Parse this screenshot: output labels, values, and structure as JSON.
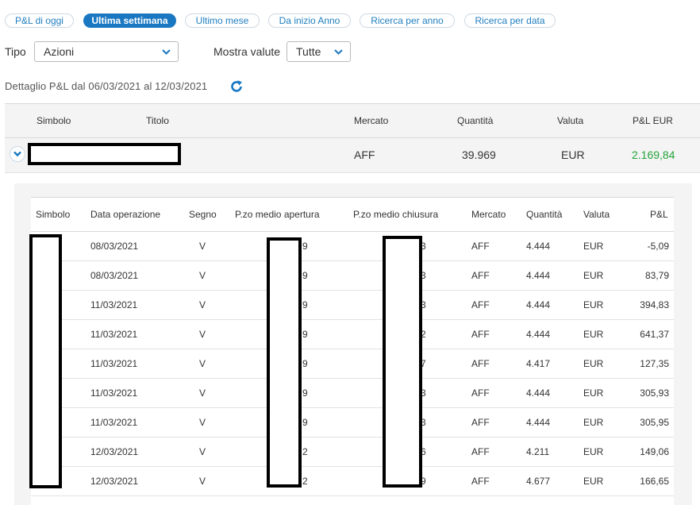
{
  "tabs": [
    {
      "label": "P&L di oggi",
      "active": false
    },
    {
      "label": "Ultima settimana",
      "active": true
    },
    {
      "label": "Ultimo mese",
      "active": false
    },
    {
      "label": "Da inizio Anno",
      "active": false
    },
    {
      "label": "Ricerca per anno",
      "active": false
    },
    {
      "label": "Ricerca per data",
      "active": false
    }
  ],
  "filters": {
    "tipo_label": "Tipo",
    "tipo_value": "Azioni",
    "valute_label": "Mostra valute",
    "valute_value": "Tutte"
  },
  "detail_text": "Dettaglio P&L dal 06/03/2021 al 12/03/2021",
  "main_table": {
    "headers": {
      "simbolo": "Simbolo",
      "titolo": "Titolo",
      "mercato": "Mercato",
      "quantita": "Quantità",
      "valuta": "Valuta",
      "pl": "P&L EUR"
    },
    "row": {
      "mercato": "AFF",
      "quantita": "39.969",
      "valuta": "EUR",
      "pl": "2.169,84"
    }
  },
  "sub_table": {
    "headers": {
      "simbolo": "Simbolo",
      "data": "Data operazione",
      "segno": "Segno",
      "apertura": "P.zo medio apertura",
      "chiusura": "P.zo medio chiusura",
      "mercato": "Mercato",
      "quantita": "Quantità",
      "valuta": "Valuta",
      "pl": "P&L"
    },
    "rows": [
      {
        "data": "08/03/2021",
        "segno": "V",
        "ap_tail": "9",
        "ch_tail": "3",
        "mercato": "AFF",
        "quantita": "4.444",
        "valuta": "EUR",
        "pl": "-5,09",
        "neg": true
      },
      {
        "data": "08/03/2021",
        "segno": "V",
        "ap_tail": "9",
        "ch_tail": "3",
        "mercato": "AFF",
        "quantita": "4.444",
        "valuta": "EUR",
        "pl": "83,79",
        "neg": false
      },
      {
        "data": "11/03/2021",
        "segno": "V",
        "ap_tail": "9",
        "ch_tail": "3",
        "mercato": "AFF",
        "quantita": "4.444",
        "valuta": "EUR",
        "pl": "394,83",
        "neg": false
      },
      {
        "data": "11/03/2021",
        "segno": "V",
        "ap_tail": "9",
        "ch_tail": "2",
        "mercato": "AFF",
        "quantita": "4.444",
        "valuta": "EUR",
        "pl": "641,37",
        "neg": false
      },
      {
        "data": "11/03/2021",
        "segno": "V",
        "ap_tail": "9",
        "ch_tail": "7",
        "mercato": "AFF",
        "quantita": "4.417",
        "valuta": "EUR",
        "pl": "127,35",
        "neg": false
      },
      {
        "data": "11/03/2021",
        "segno": "V",
        "ap_tail": "9",
        "ch_tail": "3",
        "mercato": "AFF",
        "quantita": "4.444",
        "valuta": "EUR",
        "pl": "305,93",
        "neg": false
      },
      {
        "data": "11/03/2021",
        "segno": "V",
        "ap_tail": "9",
        "ch_tail": "3",
        "mercato": "AFF",
        "quantita": "4.444",
        "valuta": "EUR",
        "pl": "305,95",
        "neg": false
      },
      {
        "data": "12/03/2021",
        "segno": "V",
        "ap_tail": "2",
        "ch_tail": "6",
        "mercato": "AFF",
        "quantita": "4.211",
        "valuta": "EUR",
        "pl": "149,06",
        "neg": false
      },
      {
        "data": "12/03/2021",
        "segno": "V",
        "ap_tail": "2",
        "ch_tail": "9",
        "mercato": "AFF",
        "quantita": "4.677",
        "valuta": "EUR",
        "pl": "166,65",
        "neg": false
      }
    ]
  },
  "colors": {
    "accent": "#1a78c2",
    "positive": "#23a23a",
    "negative": "#e0262a"
  },
  "icons": {
    "refresh": "refresh-icon",
    "expand": "chevron-down-icon",
    "select": "chevron-down-icon"
  }
}
